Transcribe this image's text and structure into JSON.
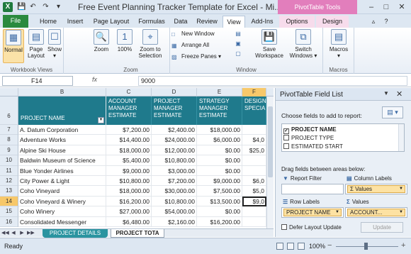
{
  "window": {
    "title": "Free Event Planning Tracker Template for Excel  -  Mi...",
    "contextual_group": "PivotTable Tools",
    "app_icon": "X",
    "quick_access": [
      "save-icon",
      "undo-icon",
      "redo-icon",
      "customize-icon"
    ]
  },
  "tabs": [
    "File",
    "Home",
    "Insert",
    "Page Layout",
    "Formulas",
    "Data",
    "Review",
    "View",
    "Add-Ins",
    "Options",
    "Design"
  ],
  "active_tab": "View",
  "ribbon": {
    "workbook_views": {
      "label": "Workbook Views",
      "normal": "Normal",
      "page_layout_1": "Page",
      "page_layout_2": "Layout",
      "show": "Show"
    },
    "zoom": {
      "label": "Zoom",
      "zoom": "Zoom",
      "hundred": "100%",
      "zoom_to_1": "Zoom to",
      "zoom_to_2": "Selection"
    },
    "window": {
      "label": "Window",
      "new_window": "New Window",
      "arrange_all": "Arrange All",
      "freeze_panes": "Freeze Panes",
      "save_ws_1": "Save",
      "save_ws_2": "Workspace",
      "switch_1": "Switch",
      "switch_2": "Windows"
    },
    "macros": {
      "label": "Macros",
      "macros": "Macros"
    }
  },
  "formula_bar": {
    "name_box": "F14",
    "fx": "fx",
    "value": "9000"
  },
  "sheet": {
    "columns": [
      "B",
      "C",
      "D",
      "E",
      "F"
    ],
    "active_column": "F",
    "header_row_num": "6",
    "headers": {
      "project_name": "PROJECT NAME",
      "c": "ACCOUNT MANAGER ESTIMATE",
      "d": "PROJECT MANAGER ESTIMATE",
      "e": "STRATEGY MANAGER ESTIMATE",
      "f": "DESIGN SPECIAL"
    },
    "rows": [
      {
        "num": "7",
        "name": "A. Datum Corporation",
        "c": "$7,200.00",
        "d": "$2,400.00",
        "e": "$18,000.00",
        "f": ""
      },
      {
        "num": "8",
        "name": "Adventure Works",
        "c": "$14,400.00",
        "d": "$24,000.00",
        "e": "$6,000.00",
        "f": "$4,0"
      },
      {
        "num": "9",
        "name": "Alpine Ski House",
        "c": "$18,000.00",
        "d": "$12,000.00",
        "e": "$0.00",
        "f": "$25,0"
      },
      {
        "num": "10",
        "name": "Baldwin Museum of Science",
        "c": "$5,400.00",
        "d": "$10,800.00",
        "e": "$0.00",
        "f": ""
      },
      {
        "num": "11",
        "name": "Blue Yonder Airlines",
        "c": "$9,000.00",
        "d": "$3,000.00",
        "e": "$0.00",
        "f": ""
      },
      {
        "num": "12",
        "name": "City Power & Light",
        "c": "$10,800.00",
        "d": "$7,200.00",
        "e": "$9,000.00",
        "f": "$6,0"
      },
      {
        "num": "13",
        "name": "Coho Vineyard",
        "c": "$18,000.00",
        "d": "$30,000.00",
        "e": "$7,500.00",
        "f": "$5,0"
      },
      {
        "num": "14",
        "name": "Coho Vineyard & Winery",
        "c": "$16,200.00",
        "d": "$10,800.00",
        "e": "$13,500.00",
        "f": "$9,0"
      },
      {
        "num": "15",
        "name": "Coho Winery",
        "c": "$27,000.00",
        "d": "$54,000.00",
        "e": "$0.00",
        "f": ""
      },
      {
        "num": "16",
        "name": "Consolidated Messenger",
        "c": "$6,480.00",
        "d": "$2,160.00",
        "e": "$16,200.00",
        "f": ""
      }
    ],
    "active_row": "14",
    "sheet_tabs": [
      "PROJECT DETAILS",
      "PROJECT TOTA"
    ]
  },
  "pivot": {
    "title": "PivotTable Field List",
    "choose_label": "Choose fields to add to report:",
    "fields": [
      {
        "label": "PROJECT NAME",
        "checked": true
      },
      {
        "label": "PROJECT TYPE",
        "checked": false
      },
      {
        "label": "ESTIMATED START",
        "checked": false
      }
    ],
    "drag_label": "Drag fields between areas below:",
    "report_filter": "Report Filter",
    "column_labels": "Column Labels",
    "row_labels": "Row Labels",
    "values": "Values",
    "column_pill": "Σ Values",
    "row_pill": "PROJECT NAME",
    "values_pill": "ACCOUNT...",
    "defer": "Defer Layout Update",
    "update": "Update"
  },
  "status": {
    "ready": "Ready",
    "zoom": "100%"
  }
}
